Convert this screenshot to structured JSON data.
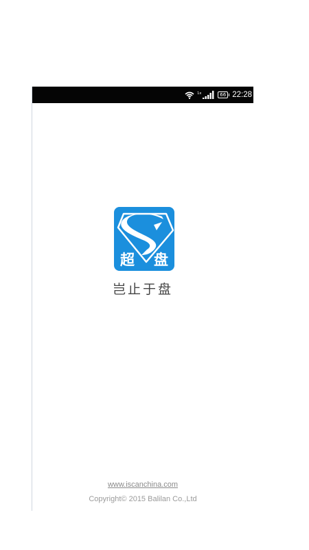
{
  "status_bar": {
    "network_type": "1x",
    "battery": "66",
    "time": "22:28",
    "icons": [
      "wifi-icon",
      "signal-icon",
      "battery-icon"
    ]
  },
  "splash": {
    "logo_text_left": "超",
    "logo_text_right": "盘",
    "slogan": "岂止于盘",
    "website": "www.iscanchina.com",
    "copyright": "Copyright© 2015 Balilan Co.,Ltd"
  },
  "colors": {
    "status_bar_bg": "#050505",
    "logo_bg": "#1b8fdd",
    "background": "#ffffff",
    "slogan": "#444444",
    "footer_text": "#8a8a8a"
  }
}
